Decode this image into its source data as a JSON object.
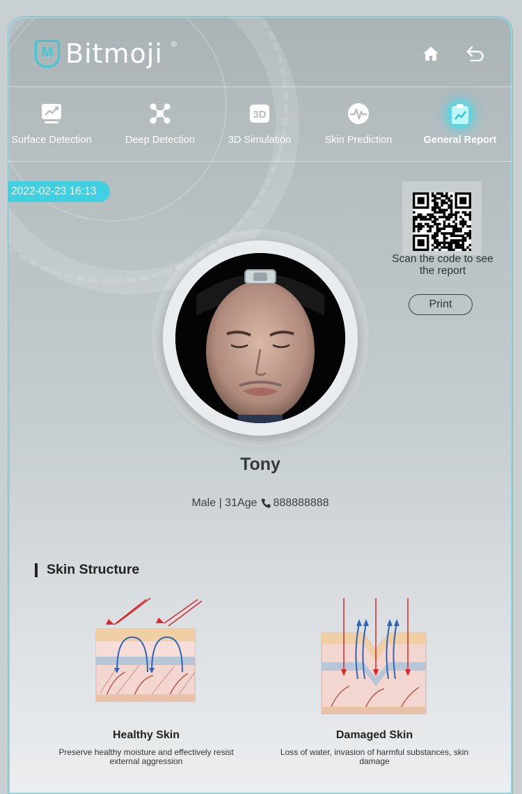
{
  "app": {
    "brand": "Bitmoji",
    "brand_mark": "®"
  },
  "header": {
    "home_icon": "home-icon",
    "back_icon": "back-arrow-icon"
  },
  "nav": {
    "items": [
      {
        "label": "Surface Detection",
        "icon": "chart-trend-icon",
        "active": false
      },
      {
        "label": "Deep Detection",
        "icon": "molecule-icon",
        "active": false
      },
      {
        "label": "3D Simulation",
        "icon": "3d-box-icon",
        "active": false
      },
      {
        "label": "Skin Prediction",
        "icon": "pulse-icon",
        "active": false
      },
      {
        "label": "General Report",
        "icon": "clipboard-chart-icon",
        "active": true
      }
    ]
  },
  "report": {
    "datetime": "2022-02-23 16:13",
    "qr_caption": "Scan the code to see the report",
    "print_label": "Print"
  },
  "profile": {
    "name": "Tony",
    "gender_age": "Male | 31Age",
    "phone": "888888888"
  },
  "skin_structure": {
    "title": "Skin Structure",
    "healthy": {
      "title": "Healthy Skin",
      "description": "Preserve healthy moisture and effectively resist external aggression"
    },
    "damaged": {
      "title": "Damaged Skin",
      "description": "Loss of water, invasion of harmful substances, skin damage"
    }
  },
  "colors": {
    "accent": "#3fd0e2",
    "active_glow": "#2fe0f2",
    "text_dark": "#222222",
    "arrow_red": "#d8262a",
    "arrow_blue": "#2d63b8"
  }
}
